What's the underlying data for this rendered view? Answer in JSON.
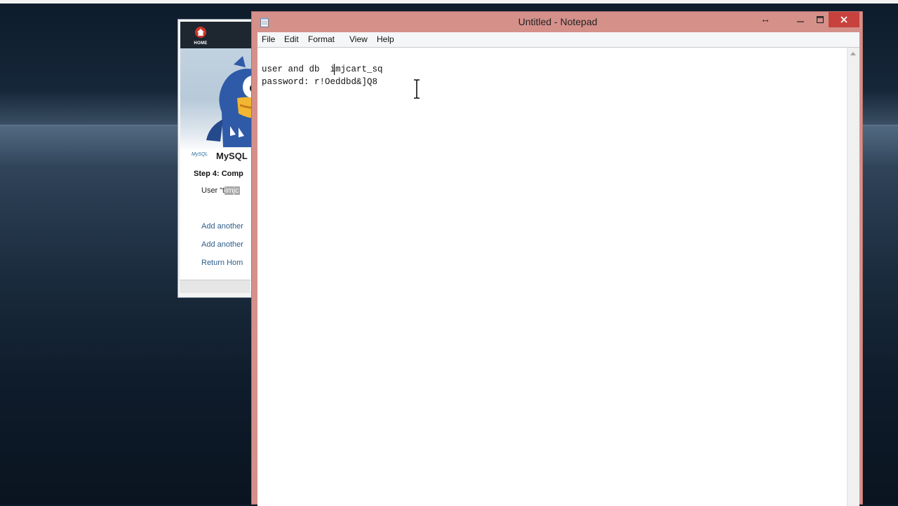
{
  "background_window": {
    "home_label": "HOME",
    "mysql_logo_text": "MySQL",
    "section_title": "MySQL",
    "step_title": "Step 4: Comp",
    "user_prefix": "User “t",
    "user_highlight": "imjc",
    "links": [
      {
        "label": "Add another"
      },
      {
        "label": "Add another"
      },
      {
        "label": "Return Hom"
      }
    ]
  },
  "notepad": {
    "title": "Untitled - Notepad",
    "menu": [
      "File",
      "Edit",
      "Format",
      "View",
      "Help"
    ],
    "lines": [
      "user and db  imjcart_sq",
      "password: r!Oeddbd&]Q8"
    ]
  },
  "colors": {
    "titlebar": "#d5908a",
    "close_button": "#c7423d",
    "link": "#2f5d8a"
  }
}
